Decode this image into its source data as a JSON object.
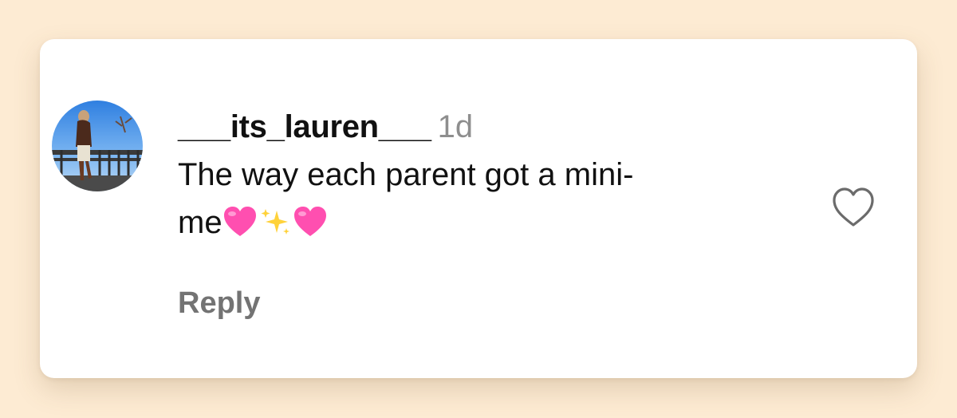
{
  "comment": {
    "username": "___its_lauren___",
    "time_ago": "1d",
    "text_line1": "The way each parent got a mini-",
    "text_line2": "me",
    "emojis": [
      "pink-heart",
      "sparkles",
      "pink-heart"
    ],
    "reply_label": "Reply",
    "like_icon": "heart-outline-icon"
  },
  "colors": {
    "background": "#fdebd3",
    "card": "#ffffff",
    "text": "#111111",
    "muted": "#8e8e8e",
    "reply": "#737373",
    "heart_emoji": "#ff4fb0"
  }
}
